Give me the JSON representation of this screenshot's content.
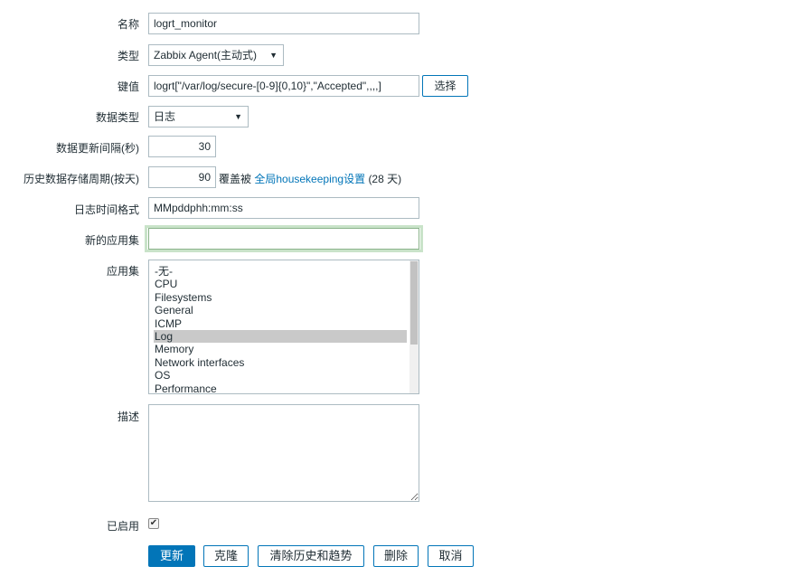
{
  "form": {
    "name": {
      "label": "名称",
      "value": "logrt_monitor"
    },
    "type": {
      "label": "类型",
      "value": "Zabbix Agent(主动式)"
    },
    "key": {
      "label": "键值",
      "value": "logrt[\"/var/log/secure-[0-9]{0,10}\",\"Accepted\",,,,]",
      "select_label": "选择"
    },
    "data_type": {
      "label": "数据类型",
      "value": "日志"
    },
    "update_interval": {
      "label": "数据更新间隔(秒)",
      "value": "30"
    },
    "history": {
      "label": "历史数据存储周期(按天)",
      "value": "90",
      "override_text": "覆盖被",
      "link_text": "全局housekeeping设置",
      "days_text": "(28 天)"
    },
    "log_time_format": {
      "label": "日志时间格式",
      "value": "MMpddphh:mm:ss"
    },
    "new_application": {
      "label": "新的应用集",
      "value": ""
    },
    "applications": {
      "label": "应用集",
      "options": [
        "-无-",
        "CPU",
        "Filesystems",
        "General",
        "ICMP",
        "Log",
        "Memory",
        "Network interfaces",
        "OS",
        "Performance"
      ],
      "selected": "Log"
    },
    "description": {
      "label": "描述",
      "value": ""
    },
    "enabled": {
      "label": "已启用",
      "checked": true
    }
  },
  "buttons": {
    "update": "更新",
    "clone": "克隆",
    "clear_history": "清除历史和趋势",
    "delete": "删除",
    "cancel": "取消"
  },
  "colors": {
    "accent": "#0275b8",
    "border": "#acbbc2",
    "focus_ring": "#c9e3c9",
    "selected_option": "#c9c9c9"
  }
}
